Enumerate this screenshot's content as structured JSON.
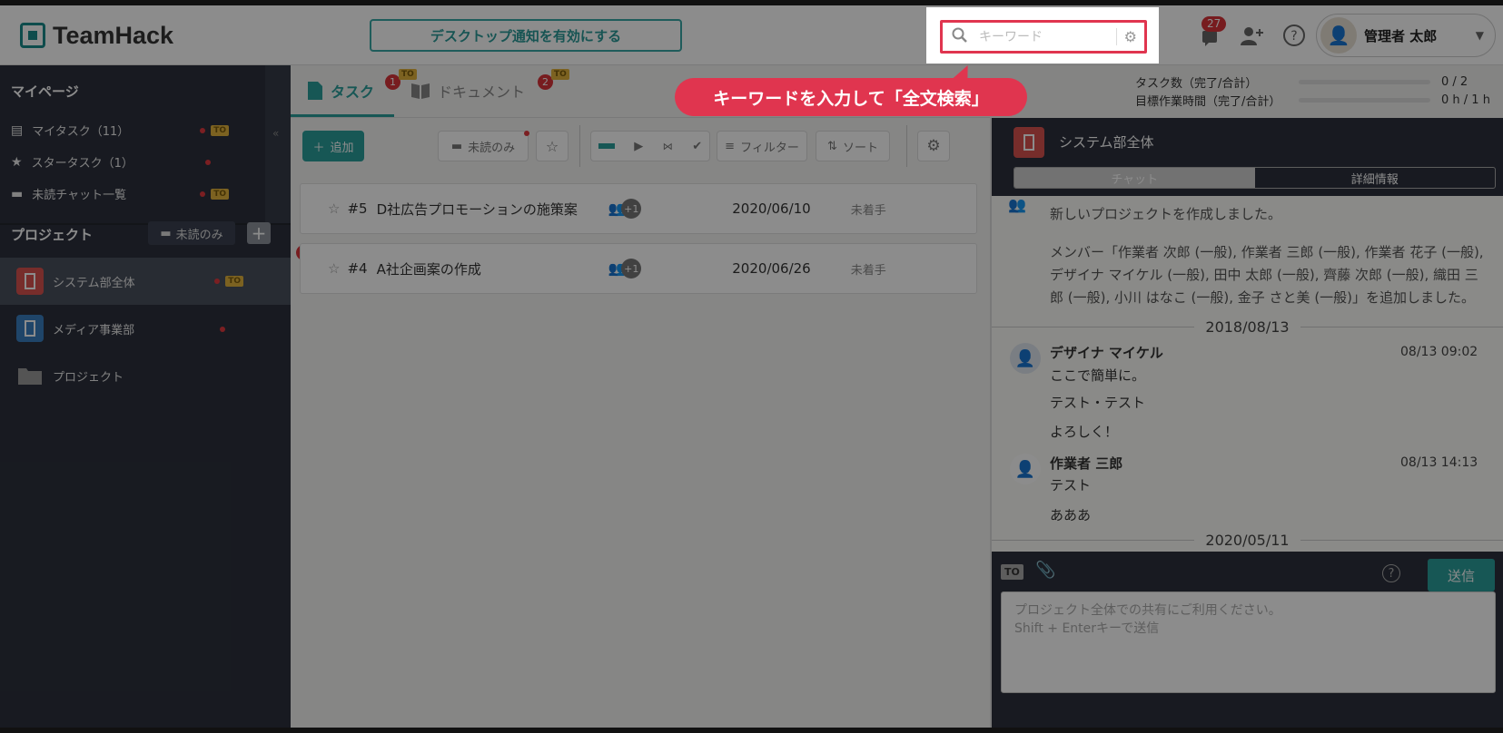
{
  "header": {
    "logo": "TeamHack",
    "notify_button": "デスクトップ通知を有効にする",
    "search_placeholder": "キーワード",
    "notif_count": "27",
    "user_name": "管理者 太郎"
  },
  "sidebar": {
    "mypage_title": "マイページ",
    "mypage_items": [
      {
        "label": "マイタスク（11）",
        "icon": "task-icon"
      },
      {
        "label": "スタータスク（1）",
        "icon": "star-icon"
      },
      {
        "label": "未読チャット一覧",
        "icon": "chat-icon"
      }
    ],
    "to_tag": "TO",
    "project_title": "プロジェクト",
    "unread_only": "未読のみ",
    "projects": [
      {
        "label": "システム部全体",
        "color": "#d9534f"
      },
      {
        "label": "メディア事業部",
        "color": "#3a7ebf"
      },
      {
        "label": "プロジェクト",
        "color": "#999999"
      }
    ]
  },
  "main": {
    "tab_task": "タスク",
    "tab_task_badge": "1",
    "tab_doc": "ドキュメント",
    "tab_doc_badge": "2",
    "add_button": "追加",
    "unread_only": "未読のみ",
    "filter": "フィルター",
    "sort": "ソート",
    "tasks": [
      {
        "number": "#5",
        "title": "D社広告プロモーションの施策案",
        "date": "2020/06/10",
        "status": "未着手",
        "badge": ""
      },
      {
        "number": "#4",
        "title": "A社企画案の作成",
        "date": "2020/06/26",
        "status": "未着手",
        "badge": "1"
      }
    ],
    "plus_one": "+1"
  },
  "stats": {
    "task_count_label": "タスク数（完了/合計）",
    "task_count_value": "0 / 2",
    "time_label": "目標作業時間（完了/合計）",
    "time_value": "0 h / 1 h"
  },
  "chat": {
    "project_name": "システム部全体",
    "tab_chat": "チャット",
    "tab_detail": "詳細情報",
    "system_msg_1": "新しいプロジェクトを作成しました。",
    "system_msg_2": "メンバー「作業者 次郎 (一般), 作業者 三郎 (一般), 作業者 花子 (一般), デザイナ マイケル (一般), 田中 太郎 (一般), 齊藤 次郎 (一般), 織田 三郎 (一般), 小川 はなこ (一般), 金子 さと美 (一般)」を追加しました。",
    "date1": "2018/08/13",
    "msg1_author": "デザイナ マイケル",
    "msg1_time": "08/13 09:02",
    "msg1_lines": [
      "ここで簡単に。",
      "テスト・テスト",
      "よろしく！"
    ],
    "msg2_author": "作業者 三郎",
    "msg2_time": "08/13 14:13",
    "msg2_lines": [
      "テスト",
      "あああ"
    ],
    "date2": "2020/05/11",
    "send": "送信",
    "input_placeholder": "プロジェクト全体での共有にご利用ください。\nShift + Enterキーで送信"
  },
  "callout": "キーワードを入力して「全文検索」",
  "colors": {
    "accent": "#2a9e9b",
    "highlight": "#e0354f",
    "sidebar": "#2c313d"
  }
}
